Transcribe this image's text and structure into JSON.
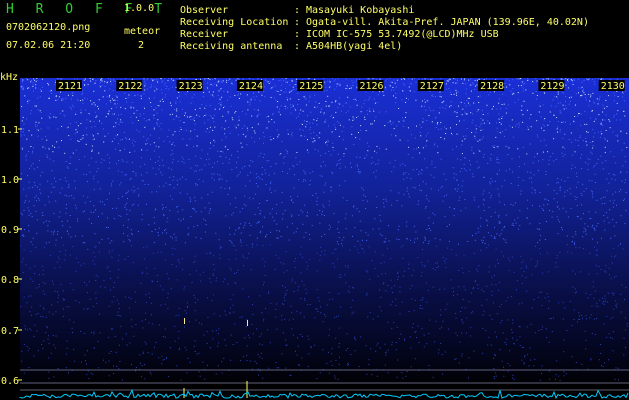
{
  "app": {
    "name": "H R O F F T",
    "version": "1.0.0"
  },
  "file": {
    "name": "0702062120.png",
    "datetime": "07.02.06 21:20"
  },
  "meteor": {
    "label": "meteor",
    "count": "2"
  },
  "info": {
    "rows": [
      {
        "label": "Observer",
        "sep": ":",
        "value": "Masayuki Kobayashi"
      },
      {
        "label": "Receiving Location",
        "sep": ":",
        "value": "Ogata-vill. Akita-Pref. JAPAN (139.96E, 40.02N)"
      },
      {
        "label": "Receiver",
        "sep": ":",
        "value": "ICOM IC-575 53.7492(@LCD)MHz USB"
      },
      {
        "label": "Receiving antenna",
        "sep": ":",
        "value": "A504HB(yagi 4el)"
      }
    ]
  },
  "axis": {
    "unit": "kHz",
    "time_ticks": [
      "2121",
      "2122",
      "2123",
      "2124",
      "2125",
      "2126",
      "2127",
      "2128",
      "2129",
      "2130"
    ],
    "freq_ticks": [
      "1.1",
      "1.0",
      "0.9",
      "0.8",
      "0.7",
      "0.6"
    ]
  },
  "colors": {
    "text": "#ffff66",
    "title": "#33cc33",
    "bg": "#000000",
    "noise": "#1e3cff",
    "trace": "#00ccff"
  }
}
